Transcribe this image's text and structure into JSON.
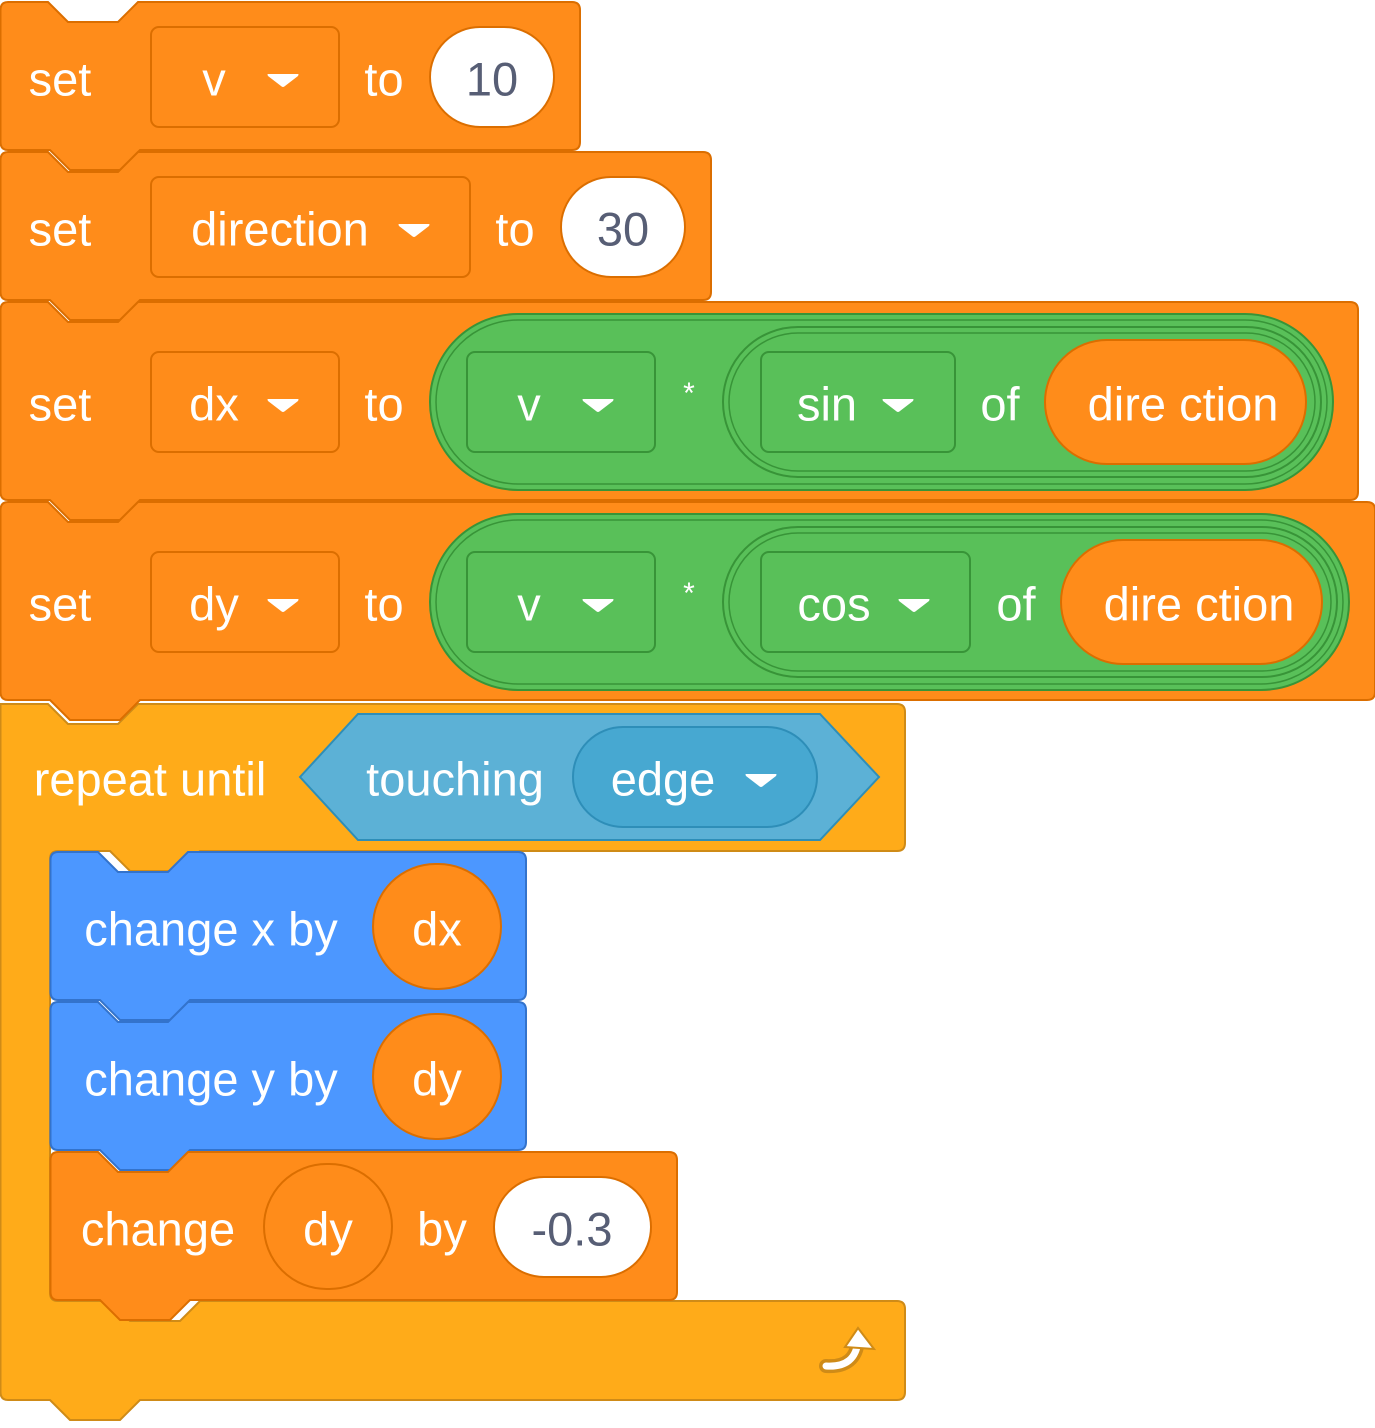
{
  "colors": {
    "variables": "#ff8c1a",
    "variables_border": "#db6e00",
    "operators": "#59c059",
    "operators_border": "#389438",
    "control": "#ffab19",
    "control_border": "#cf8b17",
    "motion": "#4c97ff",
    "motion_border": "#3373cc",
    "sensing": "#5cb1d6",
    "sensing_border": "#2e8eb8",
    "sensing_menu": "#47a8d1",
    "text": "#ffffff",
    "field_text": "#575e75"
  },
  "script": {
    "set_v": {
      "keyword": "set",
      "variable": "v",
      "to": "to",
      "value": "10"
    },
    "set_direction": {
      "keyword": "set",
      "variable": "direction",
      "to": "to",
      "value": "30"
    },
    "set_dx": {
      "keyword": "set",
      "variable": "dx",
      "to": "to",
      "operand": "v",
      "operator": "*",
      "function": "sin",
      "of": "of",
      "argument": "dire ction"
    },
    "set_dy": {
      "keyword": "set",
      "variable": "dy",
      "to": "to",
      "operand": "v",
      "operator": "*",
      "function": "cos",
      "of": "of",
      "argument": "dire ction"
    },
    "repeat_until": {
      "label": "repeat until",
      "condition": {
        "label": "touching",
        "menu": "edge"
      },
      "loop_icon": "loop-arrow-icon"
    },
    "change_x": {
      "label": "change x by",
      "value": "dx"
    },
    "change_y": {
      "label": "change y by",
      "value": "dy"
    },
    "change_var": {
      "keyword": "change",
      "variable": "dy",
      "by": "by",
      "value": "-0.3"
    }
  }
}
